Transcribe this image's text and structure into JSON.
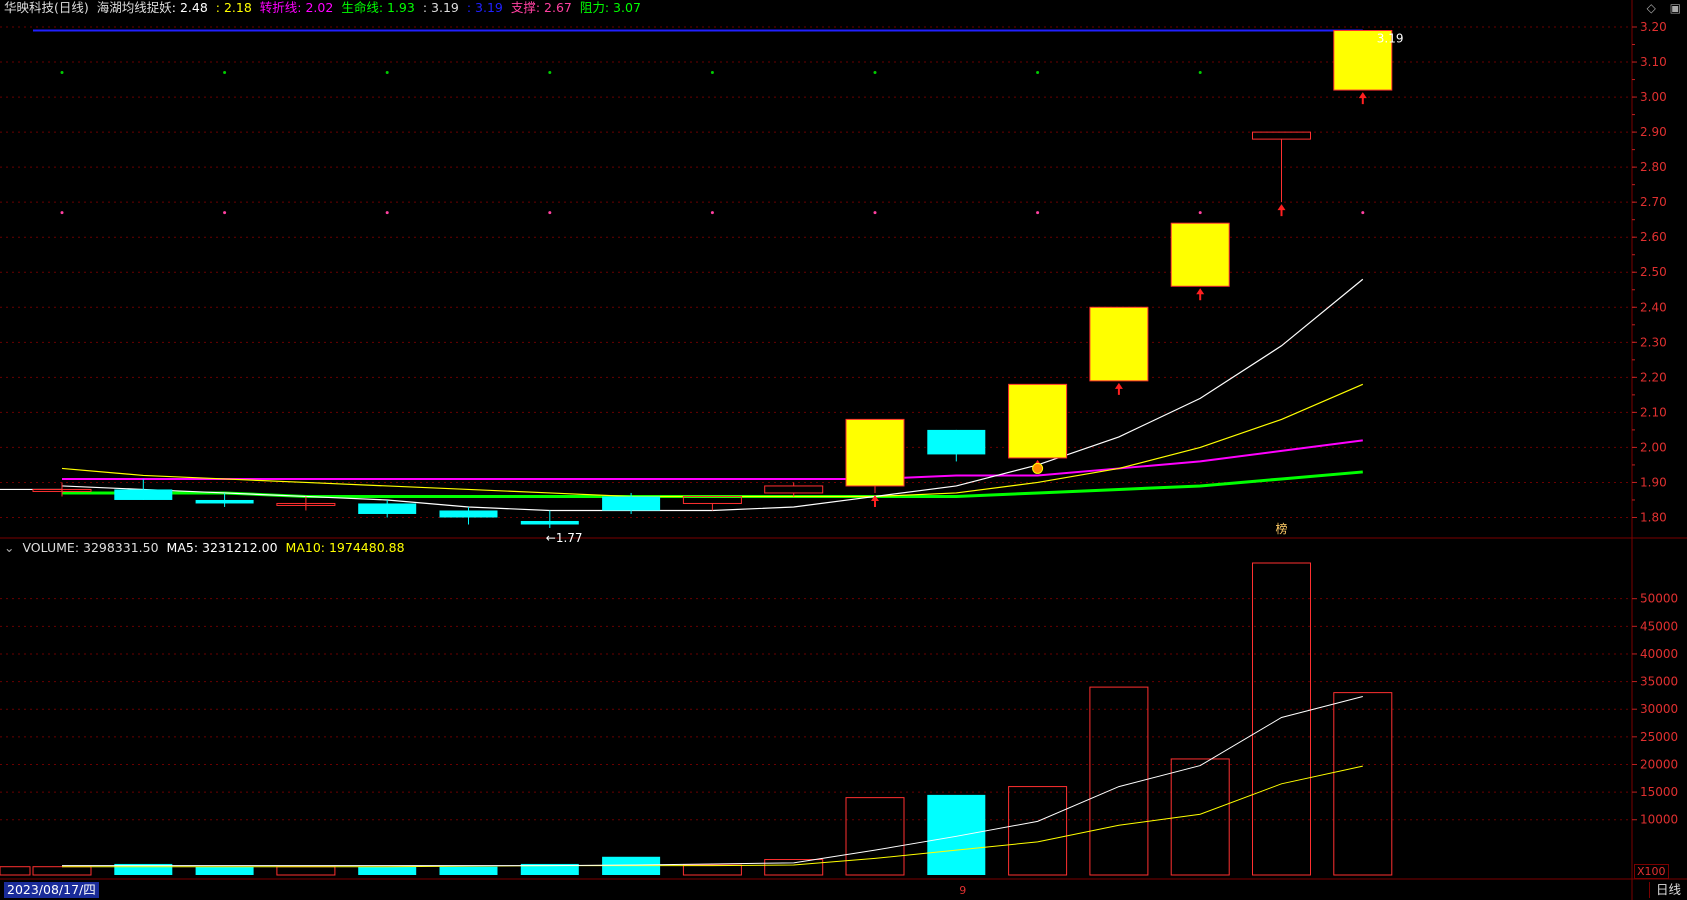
{
  "header": {
    "stock": "华映科技(日线)",
    "indicator_name": "海湖均线捉妖",
    "v1": ": 2.48",
    "v2": ": 2.18",
    "turn_label": "转折线: 2.02",
    "life_label": "生命线: 1.93",
    "v3": ": 3.19",
    "v4": ": 3.19",
    "support_label": "支撑: 2.67",
    "resist_label": "阻力: 3.07"
  },
  "volume_header": {
    "label": "VOLUME: 3298331.50",
    "ma5": "MA5: 3231212.00",
    "ma10": "MA10: 1974480.88"
  },
  "footer": {
    "date": "2023/08/17/四",
    "period": "日线",
    "multiplier": "X100",
    "mid_marker": "9"
  },
  "annotations": {
    "low": "←1.77",
    "high": "3.19",
    "bang": "榜"
  },
  "icons": [
    "diamond-icon",
    "window-icon"
  ],
  "colors": {
    "up_body": "#ffff00",
    "up_border": "#ff3030",
    "down": "#00ffff",
    "ma_white": "#ffffff",
    "ma_yellow": "#ffff00",
    "turn_line": "#ff00ff",
    "life_line": "#00ff00",
    "resist_line": "#2020ff",
    "axis": "#e03030"
  },
  "chart_data": [
    {
      "type": "candlestick",
      "title": "华映科技(日线)",
      "ylim": [
        1.75,
        3.22
      ],
      "yticks": [
        1.8,
        1.9,
        2.0,
        2.1,
        2.2,
        2.3,
        2.4,
        2.5,
        2.6,
        2.7,
        2.8,
        2.9,
        3.0,
        3.1,
        3.2
      ],
      "candles": [
        {
          "o": 1.88,
          "h": 1.9,
          "l": 1.86,
          "c": 1.88
        },
        {
          "o": 1.88,
          "h": 1.91,
          "l": 1.85,
          "c": 1.85
        },
        {
          "o": 1.85,
          "h": 1.87,
          "l": 1.83,
          "c": 1.84
        },
        {
          "o": 1.84,
          "h": 1.86,
          "l": 1.82,
          "c": 1.84
        },
        {
          "o": 1.84,
          "h": 1.85,
          "l": 1.8,
          "c": 1.81
        },
        {
          "o": 1.82,
          "h": 1.83,
          "l": 1.78,
          "c": 1.8
        },
        {
          "o": 1.79,
          "h": 1.82,
          "l": 1.77,
          "c": 1.78
        },
        {
          "o": 1.86,
          "h": 1.87,
          "l": 1.81,
          "c": 1.82
        },
        {
          "o": 1.84,
          "h": 1.86,
          "l": 1.82,
          "c": 1.86
        },
        {
          "o": 1.87,
          "h": 1.9,
          "l": 1.86,
          "c": 1.89
        },
        {
          "o": 1.89,
          "h": 2.08,
          "l": 1.87,
          "c": 2.08
        },
        {
          "o": 2.05,
          "h": 2.05,
          "l": 1.96,
          "c": 1.98
        },
        {
          "o": 1.97,
          "h": 2.18,
          "l": 1.97,
          "c": 2.18
        },
        {
          "o": 2.19,
          "h": 2.4,
          "l": 2.19,
          "c": 2.4
        },
        {
          "o": 2.46,
          "h": 2.64,
          "l": 2.46,
          "c": 2.64
        },
        {
          "o": 2.88,
          "h": 2.9,
          "l": 2.7,
          "c": 2.9
        },
        {
          "o": 3.02,
          "h": 3.19,
          "l": 3.02,
          "c": 3.19
        }
      ],
      "ma_white": [
        1.89,
        1.88,
        1.87,
        1.86,
        1.85,
        1.83,
        1.82,
        1.82,
        1.82,
        1.83,
        1.86,
        1.89,
        1.95,
        2.03,
        2.14,
        2.29,
        2.48
      ],
      "ma_yellow": [
        1.94,
        1.92,
        1.91,
        1.9,
        1.89,
        1.88,
        1.87,
        1.86,
        1.86,
        1.86,
        1.86,
        1.87,
        1.9,
        1.94,
        2.0,
        2.08,
        2.18
      ],
      "turn_line": [
        1.91,
        1.91,
        1.91,
        1.91,
        1.91,
        1.91,
        1.91,
        1.91,
        1.91,
        1.91,
        1.91,
        1.92,
        1.92,
        1.94,
        1.96,
        1.99,
        2.02
      ],
      "life_line": [
        1.87,
        1.87,
        1.87,
        1.86,
        1.86,
        1.86,
        1.86,
        1.86,
        1.86,
        1.86,
        1.86,
        1.86,
        1.87,
        1.88,
        1.89,
        1.91,
        1.93
      ],
      "support_dots": 2.67,
      "resist_dots": 3.07,
      "resist_line": 3.19,
      "signal_arrows": [
        10,
        12,
        13,
        14,
        15,
        16
      ]
    },
    {
      "type": "bar",
      "title": "VOLUME",
      "unit_multiplier": "X100",
      "ylim": [
        0,
        57000
      ],
      "yticks": [
        10000,
        15000,
        20000,
        25000,
        30000,
        35000,
        40000,
        45000,
        50000
      ],
      "values": [
        1500,
        2000,
        1500,
        1500,
        1500,
        1500,
        2000,
        3300,
        1800,
        2800,
        14000,
        14500,
        16000,
        34000,
        21000,
        58000,
        33000
      ],
      "down": [
        false,
        true,
        true,
        false,
        true,
        true,
        true,
        true,
        false,
        false,
        false,
        true,
        false,
        false,
        false,
        false,
        false
      ],
      "ma5": [
        1700,
        1700,
        1700,
        1700,
        1700,
        1700,
        1700,
        1800,
        2000,
        2200,
        4500,
        7000,
        9700,
        16000,
        19800,
        28500,
        32300
      ],
      "ma10": [
        1500,
        1500,
        1500,
        1500,
        1500,
        1600,
        1700,
        1700,
        1700,
        1800,
        3000,
        4500,
        6000,
        9000,
        11000,
        16500,
        19700
      ]
    }
  ]
}
